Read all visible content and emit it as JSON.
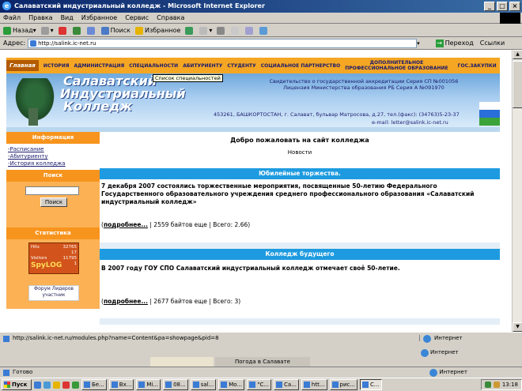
{
  "window": {
    "title": "Салаватский индустриальный колледж - Microsoft Internet Explorer"
  },
  "menu": [
    "Файл",
    "Правка",
    "Вид",
    "Избранное",
    "Сервис",
    "Справка"
  ],
  "toolbar": {
    "back": "Назад",
    "search": "Поиск",
    "favorites": "Избранное"
  },
  "address": {
    "label": "Адрес:",
    "url": "http://salink.ic-net.ru",
    "go": "Переход",
    "links": "Ссылки"
  },
  "site": {
    "nav": [
      "Главная",
      "ИСТОРИЯ",
      "АДМИНИСТРАЦИЯ",
      "СПЕЦИАЛЬНОСТИ",
      "АБИТУРИЕНТУ",
      "СТУДЕНТУ",
      "СОЦИАЛЬНОЕ ПАРТНЕРСТВО",
      "ДОПОЛНИТЕЛЬНОЕ",
      "ПРОФЕССИОНАЛЬНОЕ ОБРАЗОВАНИЕ",
      "ГОС.ЗАКУПКИ"
    ],
    "tooltip": "Список специальностей",
    "college_name": [
      "Салаватский",
      "Индустриальный",
      "Колледж"
    ],
    "accreditation_1": "Свидетельство о государственной аккредитации Серия СП №001056",
    "accreditation_2": "Лицензия Министерства образования РБ Серия А №091970",
    "address": "453261, БАШКОРТОСТАН, г. Салават, бульвар Матросова, д.27, тел.(факс): (34763)5-23-37",
    "email": "e-mail: letter@salink.ic-net.ru"
  },
  "sidebar": {
    "info_title": "Информация",
    "links": [
      "-Расписание",
      "-Абитуриенту",
      "-История колледжа"
    ],
    "search_title": "Поиск",
    "search_button": "Поиск",
    "stats_title": "Статистика",
    "stats": {
      "hits_label": "Hits",
      "hits": "32765",
      "visitors_label": "Visitors",
      "visitors": "11795",
      "c1": "17",
      "c2": "1",
      "logo": "SpyLOG"
    },
    "forum": [
      "Форум Лидеров",
      "участник"
    ]
  },
  "content": {
    "welcome": "Добро пожаловать на сайт колледжа",
    "news": "Новости",
    "articles": [
      {
        "heading": "Юбилейные торжества.",
        "text": "7 декабря 2007  состоялись торжественные мероприятия, посвященные 50-летию Федерального Государственного образовательного учреждения среднего профессионального образования «Салаватский индустриальный колледж»",
        "more": "подробнее...",
        "info": " | 2559 байтов еще | Всего: 2.66)"
      },
      {
        "heading": "Колледж будущего",
        "text": "В 2007 году ГОУ СПО Салаватский индустриальный колледж отмечает своё 50-летие.",
        "more": "подробнее...",
        "info": " | 2677 байтов еще | Всего: 3)"
      }
    ]
  },
  "status": {
    "url": "http://salink.ic-net.ru/modules.php?name=Content&pa=showpage&pid=8",
    "zone": "Интернет",
    "ready": "Готово",
    "weather": "Погода в Салавате"
  },
  "taskbar": {
    "start": "Пуск",
    "tasks": [
      "Бе...",
      "Вх...",
      "Mi...",
      "08...",
      "sal...",
      "Мо...",
      "\"С...",
      "Са...",
      "htt...",
      "рис...",
      "С..."
    ],
    "clock": "13:18"
  },
  "colors": {
    "nav_orange": "#f5a623",
    "section_blue": "#1e9be0",
    "sidebar_orange": "#f7941d"
  }
}
